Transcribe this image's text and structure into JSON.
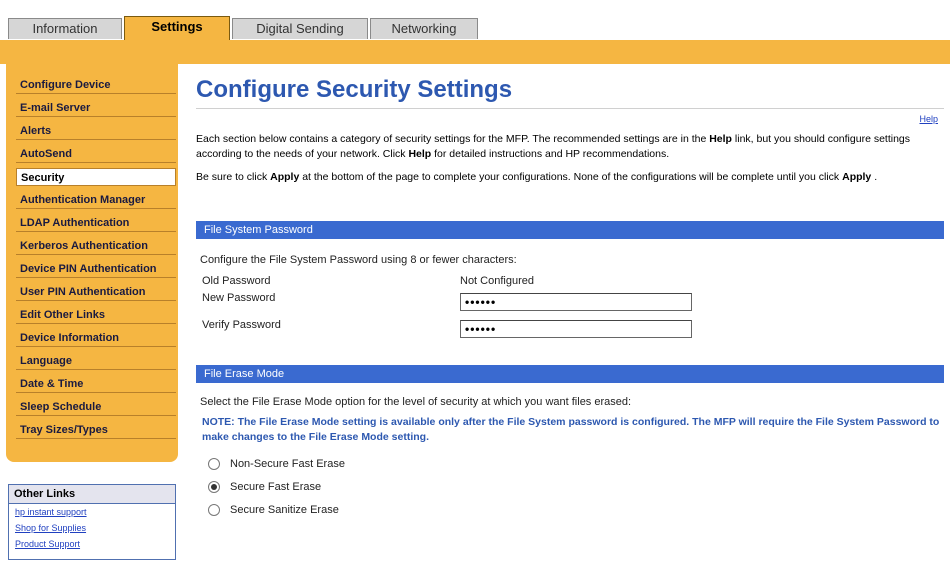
{
  "tabs": [
    {
      "label": "Information"
    },
    {
      "label": "Settings"
    },
    {
      "label": "Digital Sending"
    },
    {
      "label": "Networking"
    }
  ],
  "sidebar": {
    "items": [
      {
        "label": "Configure Device"
      },
      {
        "label": "E-mail Server"
      },
      {
        "label": "Alerts"
      },
      {
        "label": "AutoSend"
      },
      {
        "label": "Security"
      },
      {
        "label": "Authentication Manager"
      },
      {
        "label": "LDAP Authentication"
      },
      {
        "label": "Kerberos Authentication"
      },
      {
        "label": "Device PIN Authentication"
      },
      {
        "label": "User PIN Authentication"
      },
      {
        "label": "Edit Other Links"
      },
      {
        "label": "Device Information"
      },
      {
        "label": "Language"
      },
      {
        "label": "Date & Time"
      },
      {
        "label": "Sleep Schedule"
      },
      {
        "label": "Tray Sizes/Types"
      }
    ],
    "active_index": 4
  },
  "other_links": {
    "title": "Other Links",
    "links": [
      {
        "label": "hp instant support"
      },
      {
        "label": "Shop for Supplies"
      },
      {
        "label": "Product Support"
      }
    ]
  },
  "main": {
    "title": "Configure Security Settings",
    "help_label": "Help",
    "intro1_a": "Each section below contains a category of security settings for the MFP. The recommended settings are in the ",
    "intro1_help": "Help",
    "intro1_b": " link, but you should configure settings according to the needs of your network. Click ",
    "intro1_help2": "Help",
    "intro1_c": " for detailed instructions and HP recommendations.",
    "intro2_a": "Be sure to click ",
    "intro2_apply": "Apply",
    "intro2_b": " at the bottom of the page to complete your configurations. None of the configurations will be complete until you click ",
    "intro2_apply2": "Apply",
    "intro2_c": " .",
    "fs_section": "File System Password",
    "fs_desc": "Configure the File System Password using 8 or fewer characters:",
    "old_pw_label": "Old Password",
    "old_pw_value": "Not Configured",
    "new_pw_label": "New Password",
    "new_pw_value": "••••••",
    "verify_pw_label": "Verify Password",
    "verify_pw_value": "••••••",
    "erase_section": "File Erase Mode",
    "erase_desc": "Select the File Erase Mode option for the level of security at which you want files erased:",
    "erase_note": "NOTE: The File Erase Mode setting is available only after the File System password is configured. The MFP will require the File System Password to make changes to the File Erase Mode setting.",
    "erase_options": [
      {
        "label": "Non-Secure Fast Erase",
        "checked": false
      },
      {
        "label": "Secure Fast Erase",
        "checked": true
      },
      {
        "label": "Secure Sanitize Erase",
        "checked": false
      }
    ]
  },
  "colors": {
    "accent": "#f5b642",
    "section_bar": "#3a6ad0",
    "title": "#2d58b0"
  }
}
